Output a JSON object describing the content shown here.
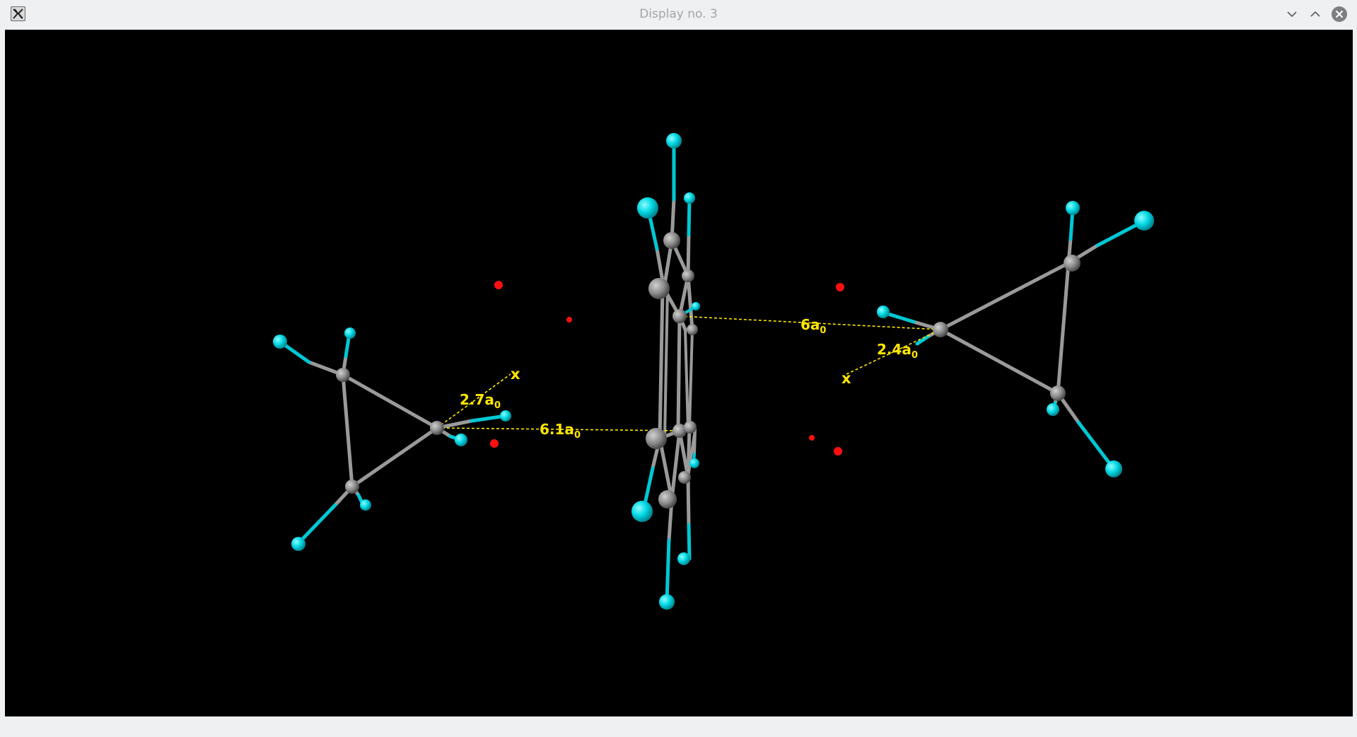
{
  "window": {
    "title": "Display no. 3"
  },
  "icons": {
    "app": "x11-icon",
    "minimize": "chevron-down-icon",
    "maximize": "chevron-up-icon",
    "close": "close-icon"
  },
  "colors": {
    "background": "#000000",
    "carbon": "#8e8e8e",
    "fluorine": "#00d4e0",
    "point": "#ff0000",
    "annotation": "#ffe600"
  },
  "measurements": [
    {
      "value": "2.7a",
      "subscript": "0"
    },
    {
      "value": "6.1a",
      "subscript": "0"
    },
    {
      "value": "6a",
      "subscript": "0"
    },
    {
      "value": "2.4a",
      "subscript": "0"
    }
  ],
  "markers": [
    {
      "label": "x"
    },
    {
      "label": "x"
    }
  ]
}
